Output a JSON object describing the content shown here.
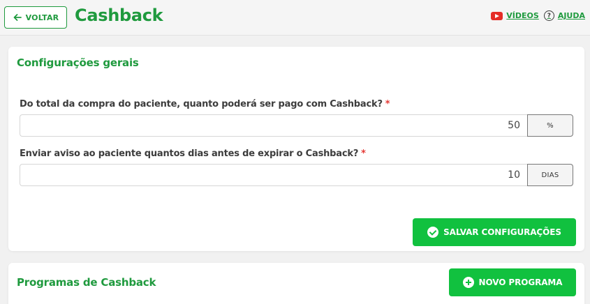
{
  "header": {
    "back_label": "VOLTAR",
    "title": "Cashback",
    "videos_label": "VÍDEOS",
    "help_label": "AJUDA"
  },
  "general_settings": {
    "title": "Configurações gerais",
    "cashback_percent": {
      "label": "Do total da compra do paciente, quanto poderá ser pago com Cashback?",
      "required_mark": "*",
      "value": "50",
      "unit": "%"
    },
    "expiry_notice": {
      "label": "Enviar aviso ao paciente quantos dias antes de expirar o Cashback?",
      "required_mark": "*",
      "value": "10",
      "unit": "DIAS"
    },
    "save_label": "SALVAR CONFIGURAÇÕES"
  },
  "programs": {
    "title": "Programas de Cashback",
    "new_program_label": "NOVO PROGRAMA"
  },
  "colors": {
    "brand_green": "#1f9a3e",
    "button_green": "#11c13f",
    "required_red": "#e53935",
    "youtube_red": "#e52d27"
  }
}
